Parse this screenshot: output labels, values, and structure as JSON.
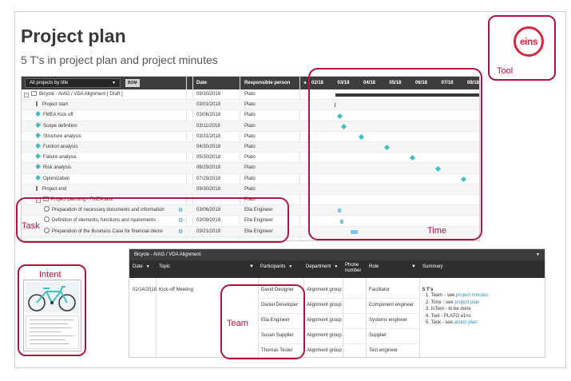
{
  "slide": {
    "title": "Project plan",
    "subtitle": "5 T's  in project plan and project minutes"
  },
  "callouts": {
    "tool": "Tool",
    "task": "Task",
    "time": "Time",
    "intent": "Intent",
    "team": "Team"
  },
  "logo": {
    "text": "eins"
  },
  "colors": {
    "callout": "#b0163c",
    "milestone": "#3fbfbf",
    "link": "#2c8fbf",
    "header": "#3d3d3d"
  },
  "gantt": {
    "filter_label": "All projects by title",
    "bom_button": "BOM",
    "columns": {
      "date": "Date",
      "responsible": "Responsible person"
    },
    "timeline_prev": "◂",
    "months": [
      "02/18",
      "03/18",
      "04/18",
      "05/18",
      "06/18",
      "07/18",
      "08/18"
    ],
    "rows": [
      {
        "name": "Bicycle - AIAG / VDA Alignment [ Draft ]",
        "date": "09/30/2018",
        "responsible": "Plato",
        "icon": "box-icon",
        "indent": 0
      },
      {
        "name": "Project start",
        "date": "03/01/2018",
        "responsible": "Plato",
        "icon": "flag-icon",
        "indent": 1
      },
      {
        "name": "FMEA Kick off",
        "date": "03/06/2018",
        "responsible": "Plato",
        "icon": "diamond-icon",
        "indent": 1
      },
      {
        "name": "Scope definition",
        "date": "03/11/2018",
        "responsible": "Plato",
        "icon": "diamond-icon",
        "indent": 1
      },
      {
        "name": "Structure analysis",
        "date": "03/31/2018",
        "responsible": "Plato",
        "icon": "diamond-icon",
        "indent": 1
      },
      {
        "name": "Funtion analysis",
        "date": "04/30/2018",
        "responsible": "Plato",
        "icon": "diamond-icon",
        "indent": 1
      },
      {
        "name": "Failure analysis",
        "date": "05/30/2018",
        "responsible": "Plato",
        "icon": "diamond-icon",
        "indent": 1
      },
      {
        "name": "Risk analysis",
        "date": "06/29/2018",
        "responsible": "Plato",
        "icon": "diamond-icon",
        "indent": 1
      },
      {
        "name": "Optimization",
        "date": "07/29/2018",
        "responsible": "Plato",
        "icon": "diamond-icon",
        "indent": 1
      },
      {
        "name": "Project end",
        "date": "09/30/2018",
        "responsible": "Plato",
        "icon": "flag-icon",
        "indent": 1
      },
      {
        "name": "Project planning - FMEA task",
        "date": "",
        "responsible": "Plato",
        "icon": "folder-icon",
        "indent": 1
      },
      {
        "name": "Preparation of necessary documents and information",
        "date": "03/06/2018",
        "responsible": "Ella Engineer",
        "icon": "task-icon",
        "indent": 2
      },
      {
        "name": "Definition of elements, functions and rquirements",
        "date": "03/09/2018",
        "responsible": "Ella Engineer",
        "icon": "task-icon",
        "indent": 2
      },
      {
        "name": "Preparation of the Business Case for financial decisi",
        "date": "03/21/2018",
        "responsible": "Ella Engineer",
        "icon": "task-icon",
        "indent": 2
      }
    ]
  },
  "minutes": {
    "title": "Bicycle - AIAG / VDA Alignment",
    "headers": {
      "date": "Date",
      "topic": "Topic",
      "participants": "Participants",
      "department": "Department",
      "phone": "Phone number",
      "role": "Role",
      "summary": "Summary"
    },
    "meeting": {
      "date": "02/14/2018",
      "topic": "Kick-off Meeting"
    },
    "participants": [
      {
        "name": "David Designer",
        "department": "Alignment group",
        "role": "Facilitator"
      },
      {
        "name": "Daniel Developer",
        "department": "Alignment group",
        "role": "Component engineer"
      },
      {
        "name": "Ella Engineer",
        "department": "Alignment group",
        "role": "Systems engineer"
      },
      {
        "name": "Susan Supplier",
        "department": "Alignment group",
        "role": "Supplier"
      },
      {
        "name": "Thomas Tester",
        "department": "Alignment group",
        "role": "Test engineer"
      }
    ],
    "summary_title": "5 T's",
    "summary_items": [
      {
        "text": "1.  Team - see ",
        "link": "project minutes"
      },
      {
        "text": "2.  Time - see ",
        "link": "project plan"
      },
      {
        "text": "3.  InTent -  to be done",
        "link": ""
      },
      {
        "text": "4.  Tool - PLATO e1ns",
        "link": ""
      },
      {
        "text": "5.  Task - see ",
        "link": "action plan"
      }
    ]
  }
}
